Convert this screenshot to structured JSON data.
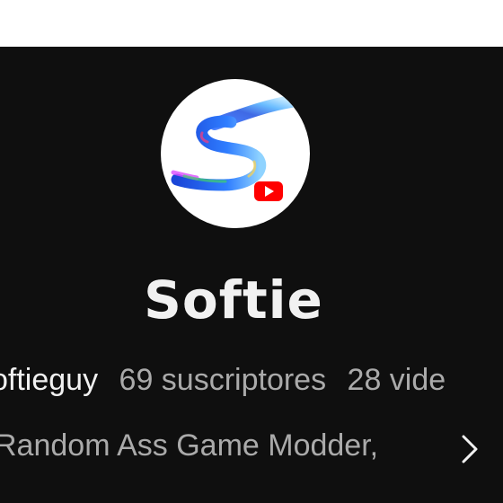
{
  "channel": {
    "name": "Softie",
    "handle": "oftieguy",
    "subscribers": "69 suscriptores",
    "videos": "28 vide",
    "description": "Random Ass Game Modder,"
  },
  "icons": {
    "avatar": "softie-logo-icon",
    "more": "chevron-right-icon"
  },
  "colors": {
    "background": "#0f0f0f",
    "primary_text": "#f1f1f1",
    "secondary_text": "#aaaaaa",
    "youtube_red": "#ff0000"
  }
}
